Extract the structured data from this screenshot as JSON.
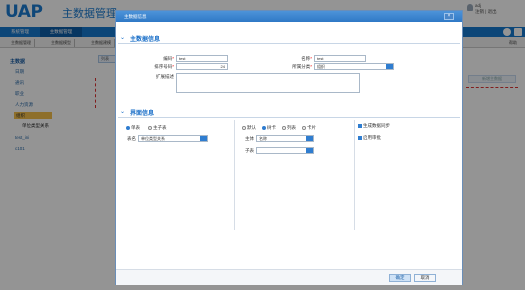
{
  "app": {
    "logo": "UAP",
    "product": "主数据管理"
  },
  "user": {
    "name": "adj",
    "links": "注销 | 退出"
  },
  "nav": {
    "tabs": [
      "系统管理",
      "主数据管理"
    ]
  },
  "subtabs": [
    "主数据管理",
    "主数据模型",
    "主数据建模"
  ],
  "help": "帮助",
  "sidebar": {
    "title": "主数据",
    "items": [
      "日期",
      "通讯",
      "职业",
      "人力资源",
      "组织",
      "test_ini",
      "c101"
    ],
    "sub_item": "单位类型关系"
  },
  "list_header": "列表",
  "right_button": "新增主数据",
  "dialog": {
    "title": "主数据信息",
    "close_icon": "×",
    "section1": {
      "title": "主数据信息"
    },
    "fields": {
      "code_label": "编码",
      "code_value": "test",
      "name_label": "名称",
      "name_value": "test",
      "order_label": "排序号码",
      "order_value": "24",
      "category_label": "所属分类",
      "category_value": "组织",
      "desc_label": "扩展描述"
    },
    "section2": {
      "title": "界面信息"
    },
    "radios_left": [
      "单表",
      "主子表"
    ],
    "style_label": "表名",
    "style_value": "单位类型关系",
    "radios_mid": [
      "默认",
      "树卡",
      "列表",
      "卡片"
    ],
    "main_label": "主体",
    "main_value": "名称",
    "sub_label": "子表",
    "checkboxes": [
      "生成数据同步",
      "启用审批"
    ],
    "ok": "确定",
    "cancel": "取消"
  }
}
